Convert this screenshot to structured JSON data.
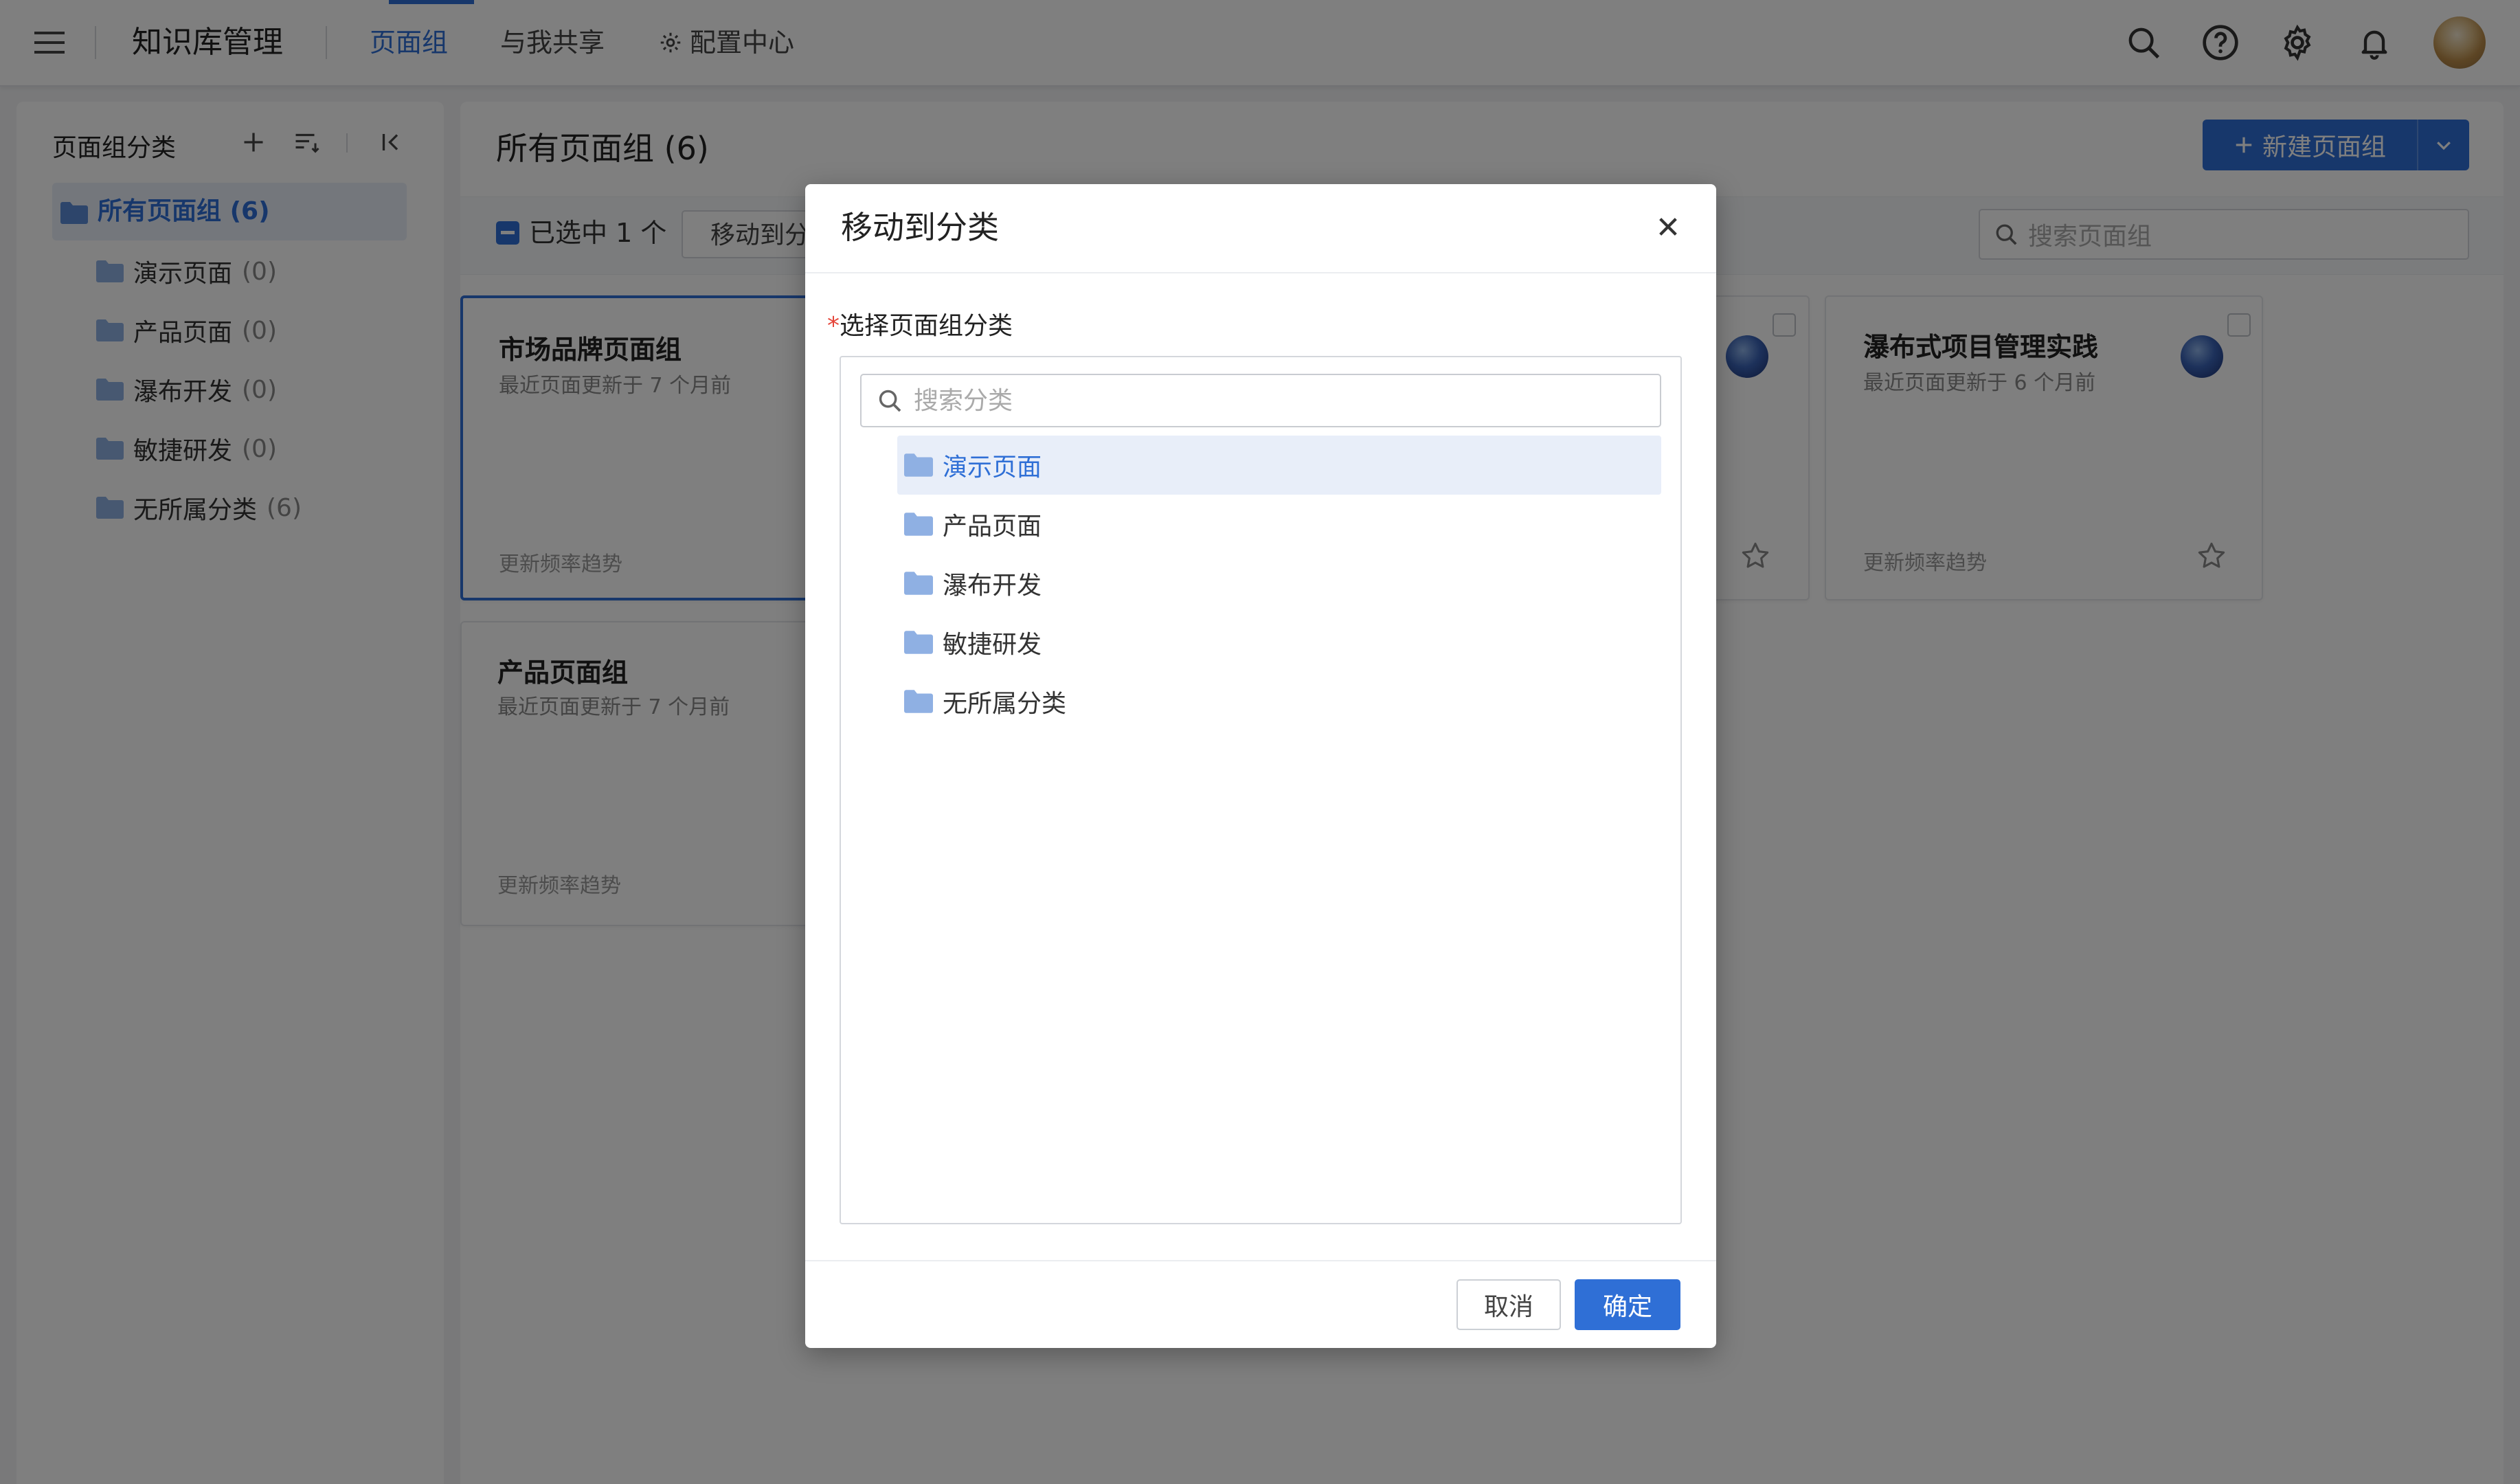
{
  "header": {
    "app_title": "知识库管理",
    "tabs": [
      {
        "label": "页面组",
        "active": true
      },
      {
        "label": "与我共享",
        "active": false
      },
      {
        "label": "配置中心",
        "active": false,
        "icon": "gear-icon"
      }
    ],
    "right_icons": [
      "search-icon",
      "help-icon",
      "settings-icon",
      "bell-icon",
      "avatar"
    ]
  },
  "sidebar": {
    "title": "页面组分类",
    "all": {
      "label": "所有页面组",
      "count": "(6)"
    },
    "items": [
      {
        "label": "演示页面",
        "count": "(0)"
      },
      {
        "label": "产品页面",
        "count": "(0)"
      },
      {
        "label": "瀑布开发",
        "count": "(0)"
      },
      {
        "label": "敏捷研发",
        "count": "(0)"
      },
      {
        "label": "无所属分类",
        "count": "(6)"
      }
    ]
  },
  "main": {
    "title": "所有页面组 (6)",
    "new_button": "新建页面组",
    "selected_text": "已选中 1 个",
    "move_button": "移动到分类",
    "search_placeholder": "搜索页面组",
    "cards": [
      {
        "title": "市场品牌页面组",
        "subtitle": "最近页面更新于 7 个月前",
        "trend": "更新频率趋势"
      },
      {
        "title": "产品页面组",
        "subtitle": "最近页面更新于 7 个月前",
        "trend": "更新频率趋势"
      },
      {
        "title": "",
        "subtitle": "",
        "trend": ""
      },
      {
        "title": "瀑布式项目管理实践",
        "subtitle": "最近页面更新于 6 个月前",
        "trend": "更新频率趋势"
      }
    ]
  },
  "modal": {
    "title": "移动到分类",
    "field_label": "选择页面组分类",
    "required_mark": "*",
    "search_placeholder": "搜索分类",
    "tree": [
      {
        "label": "演示页面",
        "selected": true
      },
      {
        "label": "产品页面",
        "selected": false
      },
      {
        "label": "瀑布开发",
        "selected": false
      },
      {
        "label": "敏捷研发",
        "selected": false
      },
      {
        "label": "无所属分类",
        "selected": false
      }
    ],
    "cancel": "取消",
    "ok": "确定"
  },
  "colors": {
    "accent": "#2f6fd6",
    "folder": "#8fb0e3",
    "overlay": "rgba(0,0,0,0.5)"
  }
}
